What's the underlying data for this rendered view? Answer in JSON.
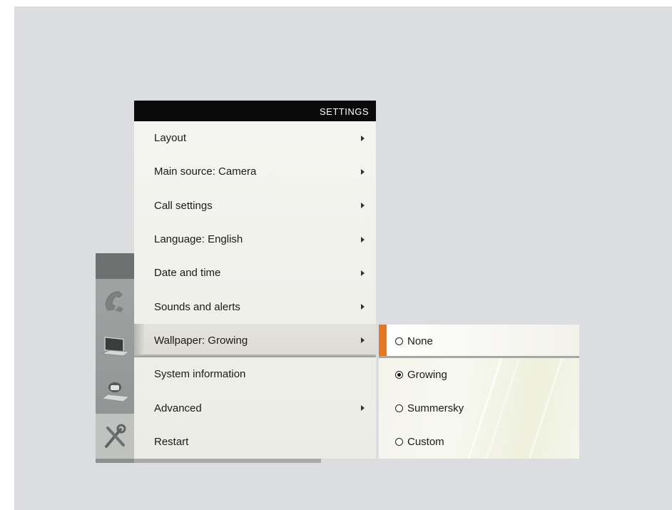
{
  "settings": {
    "title": "SETTINGS",
    "items": [
      {
        "label": "Layout",
        "has_submenu": true
      },
      {
        "label": "Main source: Camera",
        "has_submenu": true
      },
      {
        "label": "Call settings",
        "has_submenu": true
      },
      {
        "label": "Language: English",
        "has_submenu": true
      },
      {
        "label": "Date and time",
        "has_submenu": true
      },
      {
        "label": "Sounds and alerts",
        "has_submenu": true
      },
      {
        "label": "Wallpaper: Growing",
        "has_submenu": true,
        "selected": true
      },
      {
        "label": "System information",
        "has_submenu": false
      },
      {
        "label": "Advanced",
        "has_submenu": true
      },
      {
        "label": "Restart",
        "has_submenu": false
      }
    ]
  },
  "wallpaper_submenu": {
    "options": [
      {
        "label": "None",
        "checked": false,
        "focused": true
      },
      {
        "label": "Growing",
        "checked": true,
        "focused": false
      },
      {
        "label": "Summersky",
        "checked": false,
        "focused": false
      },
      {
        "label": "Custom",
        "checked": false,
        "focused": false
      }
    ]
  },
  "dock": {
    "icons": [
      "phone-icon",
      "laptop-icon",
      "camera-icon",
      "tools-icon"
    ]
  },
  "colors": {
    "background": "#dcdde0",
    "header": "#0a0a0a",
    "focus_accent": "#e87722"
  }
}
